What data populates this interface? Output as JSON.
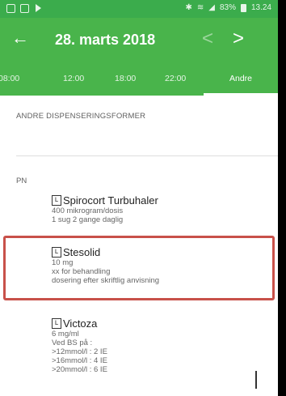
{
  "status_bar": {
    "time": "13.24",
    "battery": "83%"
  },
  "app_bar": {
    "back_symbol": "←",
    "date_title": "28. marts 2018",
    "prev_symbol": "<",
    "next_symbol": ">"
  },
  "tabs": [
    {
      "label": "08:00",
      "active": false
    },
    {
      "label": "12:00",
      "active": false
    },
    {
      "label": "18:00",
      "active": false
    },
    {
      "label": "22:00",
      "active": false
    },
    {
      "label": "Andre",
      "active": true
    }
  ],
  "section": {
    "header": "ANDRE DISPENSERINGSFORMER",
    "group_label": "PN"
  },
  "medications": [
    {
      "icon_letter": "L",
      "name": "Spirocort Turbuhaler",
      "lines": [
        "400 mikrogram/dosis",
        "1 sug 2 gange daglig"
      ],
      "highlighted": false
    },
    {
      "icon_letter": "L",
      "name": "Stesolid",
      "lines": [
        "10 mg",
        "xx for behandling",
        "dosering efter skriftlig anvisning"
      ],
      "highlighted": true
    },
    {
      "icon_letter": "L",
      "name": "Victoza",
      "lines": [
        "6 mg/ml",
        "Ved BS på :",
        ">12mmol/l : 2 IE",
        ">16mmol/l : 4 IE",
        ">20mmol/l : 6 IE"
      ],
      "highlighted": false
    }
  ],
  "colors": {
    "primary_green": "#49b44b",
    "highlight_red": "#c8514a"
  }
}
